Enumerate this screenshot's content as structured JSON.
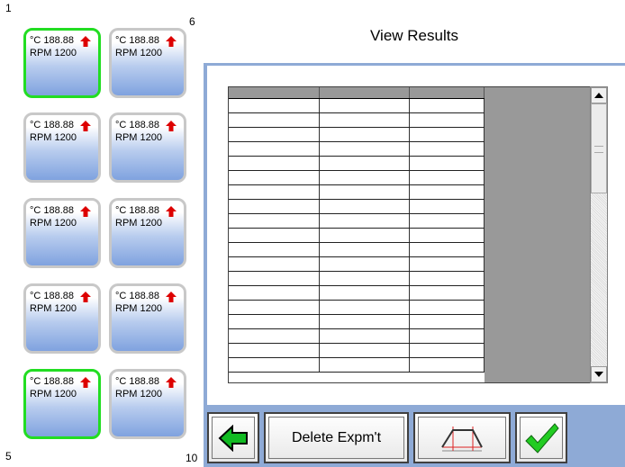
{
  "title": "View Results",
  "corners": {
    "top_left": "1",
    "top_right": "6",
    "bottom_left": "5",
    "bottom_right": "10"
  },
  "tiles": [
    {
      "temp": "°C 188.88",
      "rpm": "RPM 1200",
      "selected": true
    },
    {
      "temp": "°C 188.88",
      "rpm": "RPM 1200",
      "selected": false
    },
    {
      "temp": "°C 188.88",
      "rpm": "RPM 1200",
      "selected": false
    },
    {
      "temp": "°C 188.88",
      "rpm": "RPM 1200",
      "selected": false
    },
    {
      "temp": "°C 188.88",
      "rpm": "RPM 1200",
      "selected": false
    },
    {
      "temp": "°C 188.88",
      "rpm": "RPM 1200",
      "selected": false
    },
    {
      "temp": "°C 188.88",
      "rpm": "RPM 1200",
      "selected": false
    },
    {
      "temp": "°C 188.88",
      "rpm": "RPM 1200",
      "selected": false
    },
    {
      "temp": "°C 188.88",
      "rpm": "RPM 1200",
      "selected": true
    },
    {
      "temp": "°C 188.88",
      "rpm": "RPM 1200",
      "selected": false
    }
  ],
  "table": {
    "columns": [
      "",
      "",
      ""
    ],
    "row_count": 19
  },
  "buttons": {
    "back_icon": "green-left-arrow-icon",
    "delete_label": "Delete Expm't",
    "graph_icon": "temperature-profile-icon",
    "confirm_icon": "green-checkmark-icon"
  },
  "colors": {
    "background": "#8eaad6",
    "selected_border": "#22dd22",
    "arrow_up": "#dd0000",
    "header_gray": "#999999"
  }
}
